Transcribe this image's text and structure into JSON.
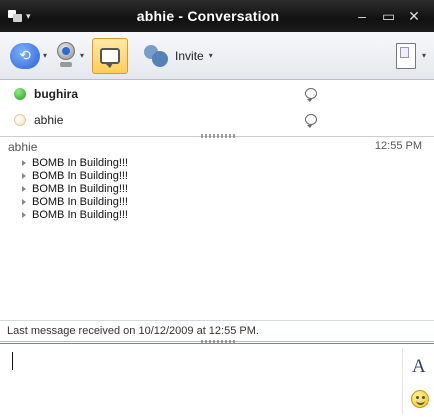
{
  "window": {
    "title": "abhie - Conversation",
    "minimize_glyph": "–",
    "maximize_glyph": "▭",
    "close_glyph": "✕"
  },
  "toolbar": {
    "invite_label": "Invite",
    "caret_glyph": "▾",
    "icons": [
      "activities-icon",
      "webcam-icon",
      "chat-icon",
      "invite-icon",
      "document-icon"
    ],
    "accent_color": "#ffcd5a"
  },
  "participants": [
    {
      "name": "bughira",
      "status": "online",
      "status_color": "#2c9a1e"
    },
    {
      "name": "abhie",
      "status": "idle",
      "status_color": "#f0e2c2"
    }
  ],
  "conversation": {
    "sender": "abhie",
    "timestamp": "12:55 PM",
    "messages": [
      "BOMB In Building!!!",
      "BOMB In Building!!!",
      "BOMB In Building!!!",
      "BOMB In Building!!!",
      "BOMB In Building!!!"
    ]
  },
  "status_bar": {
    "text": "Last message received on 10/12/2009 at 12:55 PM."
  },
  "compose": {
    "value": "",
    "font_button_label": "A"
  }
}
